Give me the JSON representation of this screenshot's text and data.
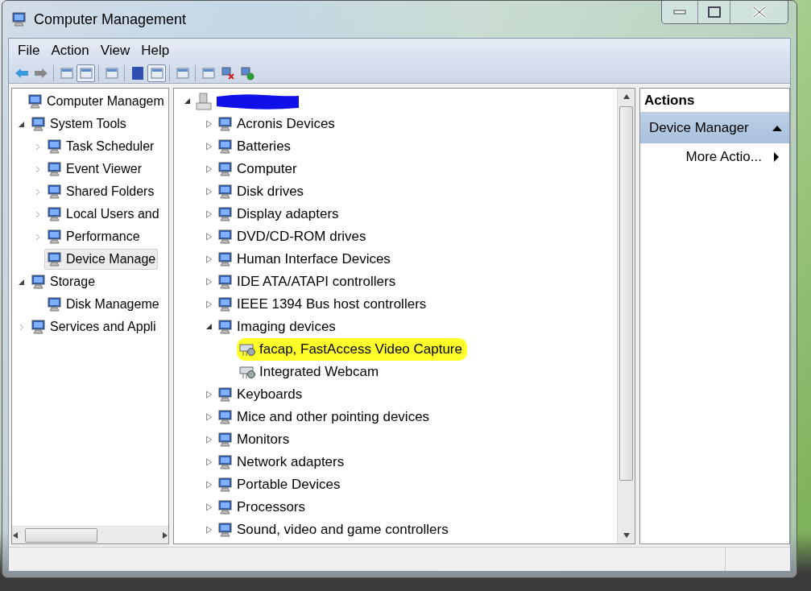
{
  "window": {
    "title": "Computer Management"
  },
  "menu": [
    "File",
    "Action",
    "View",
    "Help"
  ],
  "toolbar": [
    {
      "pressed": false
    },
    {
      "pressed": false
    },
    {
      "pressed": false
    },
    {
      "pressed": true
    },
    {
      "pressed": false
    },
    {
      "pressed": false
    },
    {
      "pressed": true
    },
    {
      "pressed": false
    },
    {
      "pressed": false
    },
    {
      "pressed": false
    },
    {
      "pressed": false
    }
  ],
  "console_tree": [
    {
      "label": "Computer Managem",
      "selected": false,
      "children": [
        {
          "label": "System Tools",
          "selected": false,
          "expanded": true,
          "children": [
            {
              "label": "Task Scheduler",
              "selected": false,
              "expanded": false
            },
            {
              "label": "Event Viewer",
              "selected": false,
              "expanded": false
            },
            {
              "label": "Shared Folders",
              "selected": false,
              "expanded": false
            },
            {
              "label": "Local Users and",
              "selected": false,
              "expanded": false
            },
            {
              "label": "Performance",
              "selected": false,
              "expanded": false
            },
            {
              "label": "Device Manage",
              "selected": true
            }
          ]
        },
        {
          "label": "Storage",
          "selected": false,
          "expanded": true,
          "children": [
            {
              "label": "Disk Manageme",
              "selected": false
            }
          ]
        },
        {
          "label": "Services and Appli",
          "selected": false,
          "expanded": false
        }
      ]
    }
  ],
  "device_tree": [
    {
      "expanded": true,
      "redacted": true,
      "children": [
        {
          "label": "Acronis Devices",
          "expanded": false
        },
        {
          "label": "Batteries",
          "expanded": false
        },
        {
          "label": "Computer",
          "expanded": false
        },
        {
          "label": "Disk drives",
          "expanded": false
        },
        {
          "label": "Display adapters",
          "expanded": false
        },
        {
          "label": "DVD/CD-ROM drives",
          "expanded": false
        },
        {
          "label": "Human Interface Devices",
          "expanded": false
        },
        {
          "label": "IDE ATA/ATAPI controllers",
          "expanded": false
        },
        {
          "label": "IEEE 1394 Bus host controllers",
          "expanded": false
        },
        {
          "label": "Imaging devices",
          "expanded": true,
          "children": [
            {
              "label": "facap, FastAccess Video Capture",
              "highlighted": true
            },
            {
              "label": "Integrated Webcam",
              "highlighted": false
            }
          ]
        },
        {
          "label": "Keyboards",
          "expanded": false
        },
        {
          "label": "Mice and other pointing devices",
          "expanded": false
        },
        {
          "label": "Monitors",
          "expanded": false
        },
        {
          "label": "Network adapters",
          "expanded": false
        },
        {
          "label": "Portable Devices",
          "expanded": false
        },
        {
          "label": "Processors",
          "expanded": false
        },
        {
          "label": "Sound, video and game controllers",
          "expanded": false
        }
      ]
    }
  ],
  "actions": {
    "header": "Actions",
    "section": {
      "label": "Device Manager",
      "expanded": true
    },
    "items": [
      "More Actio..."
    ]
  }
}
